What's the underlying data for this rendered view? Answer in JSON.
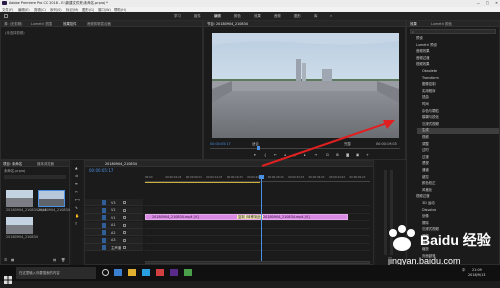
{
  "app": {
    "title": "Adobe Premiere Pro CC 2018 - E:\\新建文件夹\\未命名.prproj *",
    "window_controls": [
      "—",
      "□",
      "✕"
    ]
  },
  "menu": [
    "文件(F)",
    "编辑(E)",
    "剪辑(C)",
    "序列(S)",
    "标记(M)",
    "图形(G)",
    "窗口(W)",
    "帮助(H)"
  ],
  "workspaces": [
    "学习",
    "组件",
    "编辑",
    "颜色",
    "效果",
    "音频",
    "图形",
    "库",
    "»"
  ],
  "source_panel": {
    "tabs": [
      "源: (无剪辑)",
      "Lumetri 范围",
      "效果控件",
      "音频剪辑混合器"
    ],
    "placeholder": "(未选择剪辑)"
  },
  "program_monitor": {
    "title": "节目: 20180904_210834",
    "timecode_left": "00:00:05:17",
    "fit": "适合",
    "resolution": "完整",
    "timecode_right": "00:00:19:03"
  },
  "effects_panel": {
    "tabs": [
      "效果",
      "Lumetri 颜色"
    ],
    "search_placeholder": "",
    "items": [
      "预设",
      "Lumetri 预设",
      "音频效果",
      "音频过渡",
      "视频效果",
      "Obsolete",
      "Transform",
      "图像控制",
      "实用程序",
      "扭曲",
      "时间",
      "杂色与颗粒",
      "模糊与锐化",
      "沉浸式视频",
      "生成",
      "视频",
      "调整",
      "过时",
      "过渡",
      "透视",
      "通道",
      "键控",
      "颜色校正",
      "风格化",
      "视频过渡",
      "3D 运动",
      "Dissolve",
      "划像",
      "擦除",
      "沉浸式视频",
      "溶解",
      "滑动",
      "缩放",
      "页面剥落"
    ],
    "highlight_index": 14
  },
  "project_panel": {
    "tabs": [
      "项目: 未命名",
      "媒体浏览器"
    ],
    "filename": "未命名.prproj",
    "items": [
      {
        "label": "20180904_210834.mp4",
        "duration": "19:03"
      },
      {
        "label": "20180904_210834",
        "duration": "19:03"
      },
      {
        "label": "20180904_210834",
        "duration": "19:03"
      }
    ]
  },
  "timeline": {
    "title": "20180904_210834",
    "timecode": "00:00:05:17",
    "ruler": [
      "00:00",
      "00:00:04:23",
      "00:00:09:23",
      "00:00:14:23",
      "00:00:19:23",
      "00:00:24:23",
      "00:00:29:23",
      "00:00:34:23",
      "00:00:39:23",
      "00:00:44:23",
      "00:00:49:23"
    ],
    "tracks": [
      "V3",
      "V2",
      "V1",
      "A1",
      "A2",
      "A3",
      "主声道"
    ],
    "clip_a": "20180904_210834.mp4 [V]",
    "clip_b": "20180904_210834.mp4 [V]",
    "tooltip": "复制 (转移到此)",
    "master_value": "0.0"
  },
  "taskbar": {
    "search": "在这里输入你要搜索的内容",
    "time": "21:09",
    "date": "2018/9/13",
    "lang": "中"
  },
  "watermark": {
    "brand": "Baidu 经验",
    "url": "jingyan.baidu.com"
  }
}
